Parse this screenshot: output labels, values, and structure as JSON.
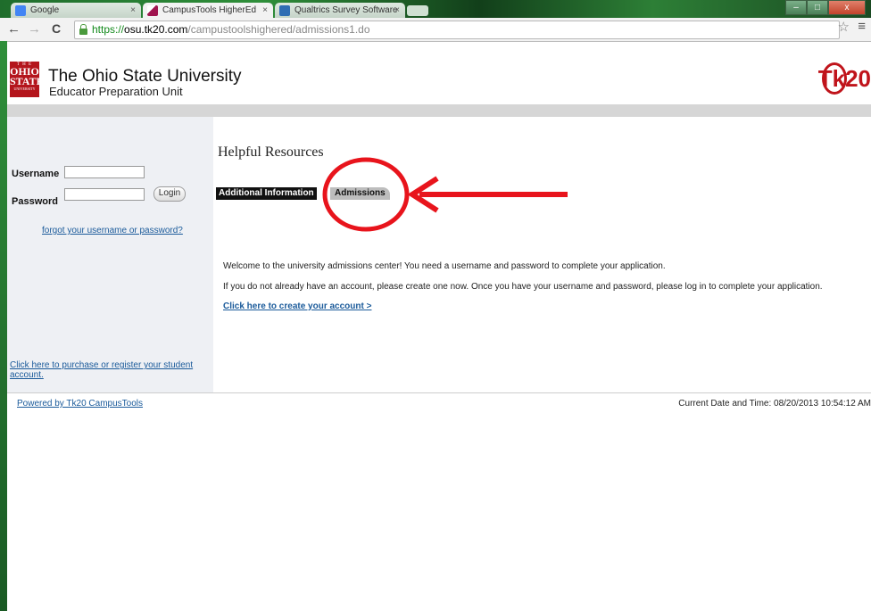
{
  "browser": {
    "tabs": [
      {
        "label": "Google",
        "icon_color": "#4285f4"
      },
      {
        "label": "CampusTools HigherEd",
        "icon_color": "#a0144f"
      },
      {
        "label": "Qualtrics Survey Software",
        "icon_color": "#2f6db3"
      }
    ],
    "tab_close": "×",
    "url_scheme": "https://",
    "url_host": "osu.tk20.com",
    "url_path": "/campustoolshighered/admissions1.do",
    "back": "←",
    "forward": "→",
    "reload": "C",
    "star": "☆",
    "menu": "≡",
    "minimize": "–",
    "maximize": "□",
    "close": "x"
  },
  "header": {
    "logo_top": "T H E",
    "logo_mid": "OHIO STATE",
    "logo_bottom": "UNIVERSITY",
    "university": "The Ohio State University",
    "unit": "Educator Preparation Unit",
    "brand": "Tk20"
  },
  "login": {
    "username_label": "Username",
    "password_label": "Password",
    "login_button": "Login",
    "forgot_link": "forgot your username or password?",
    "purchase_link": "Click here to purchase or register your student account."
  },
  "main": {
    "heading": "Helpful Resources",
    "tab_additional": "Additional Information",
    "tab_admissions": "Admissions",
    "welcome": "Welcome to the university admissions center! You need a username and password to complete your application.",
    "instructions": "If you do not already have an account, please create one now. Once you have your username and password, please log in to complete your application.",
    "create_link": "Click here to create your account >"
  },
  "footer": {
    "powered": "Powered by Tk20 CampusTools",
    "datetime": "Current Date and Time: 08/20/2013 10:54:12 AM"
  },
  "colors": {
    "accent": "#b4151c",
    "link": "#1a5a9a",
    "annotation": "#e8141c"
  }
}
